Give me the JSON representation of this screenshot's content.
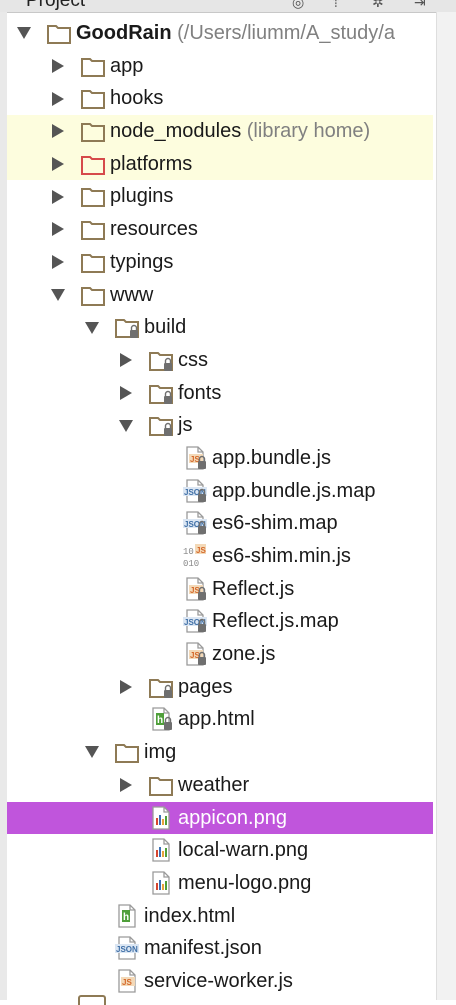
{
  "panel": {
    "title": "Project"
  },
  "colors": {
    "selection": "#c055dc",
    "highlight": "#fdfdde",
    "folder": "#8e7a55",
    "excluded_folder": "#d64a4a"
  },
  "tree": [
    {
      "name": "GoodRain",
      "note": " (/Users/liumm/A_study/a",
      "depth": 0,
      "arrow": "expanded",
      "icon": "folder",
      "bold": true
    },
    {
      "name": "app",
      "depth": 1,
      "arrow": "collapsed",
      "icon": "folder"
    },
    {
      "name": "hooks",
      "depth": 1,
      "arrow": "collapsed",
      "icon": "folder"
    },
    {
      "name": "node_modules",
      "note": " (library home)",
      "depth": 1,
      "arrow": "collapsed",
      "icon": "folder",
      "highlight": "yellow"
    },
    {
      "name": "platforms",
      "depth": 1,
      "arrow": "collapsed",
      "icon": "folder-red",
      "highlight": "yellow"
    },
    {
      "name": "plugins",
      "depth": 1,
      "arrow": "collapsed",
      "icon": "folder"
    },
    {
      "name": "resources",
      "depth": 1,
      "arrow": "collapsed",
      "icon": "folder"
    },
    {
      "name": "typings",
      "depth": 1,
      "arrow": "collapsed",
      "icon": "folder"
    },
    {
      "name": "www",
      "depth": 1,
      "arrow": "expanded",
      "icon": "folder"
    },
    {
      "name": "build",
      "depth": 2,
      "arrow": "expanded",
      "icon": "folder-locked"
    },
    {
      "name": "css",
      "depth": 3,
      "arrow": "collapsed",
      "icon": "folder-locked"
    },
    {
      "name": "fonts",
      "depth": 3,
      "arrow": "collapsed",
      "icon": "folder-locked"
    },
    {
      "name": "js",
      "depth": 3,
      "arrow": "expanded",
      "icon": "folder-locked"
    },
    {
      "name": "app.bundle.js",
      "depth": 4,
      "arrow": "none",
      "icon": "js-locked"
    },
    {
      "name": "app.bundle.js.map",
      "depth": 4,
      "arrow": "none",
      "icon": "json-locked"
    },
    {
      "name": "es6-shim.map",
      "depth": 4,
      "arrow": "none",
      "icon": "json-locked"
    },
    {
      "name": "es6-shim.min.js",
      "depth": 4,
      "arrow": "none",
      "icon": "binary-js"
    },
    {
      "name": "Reflect.js",
      "depth": 4,
      "arrow": "none",
      "icon": "js-locked"
    },
    {
      "name": "Reflect.js.map",
      "depth": 4,
      "arrow": "none",
      "icon": "json-locked"
    },
    {
      "name": "zone.js",
      "depth": 4,
      "arrow": "none",
      "icon": "js-locked"
    },
    {
      "name": "pages",
      "depth": 3,
      "arrow": "collapsed",
      "icon": "folder-locked"
    },
    {
      "name": "app.html",
      "depth": 3,
      "arrow": "none",
      "icon": "html-locked"
    },
    {
      "name": "img",
      "depth": 2,
      "arrow": "expanded",
      "icon": "folder"
    },
    {
      "name": "weather",
      "depth": 3,
      "arrow": "collapsed",
      "icon": "folder"
    },
    {
      "name": "appicon.png",
      "depth": 3,
      "arrow": "none",
      "icon": "image",
      "selected": true
    },
    {
      "name": "local-warn.png",
      "depth": 3,
      "arrow": "none",
      "icon": "image"
    },
    {
      "name": "menu-logo.png",
      "depth": 3,
      "arrow": "none",
      "icon": "image"
    },
    {
      "name": "index.html",
      "depth": 2,
      "arrow": "none",
      "icon": "html"
    },
    {
      "name": "manifest.json",
      "depth": 2,
      "arrow": "none",
      "icon": "json"
    },
    {
      "name": "service-worker.js",
      "depth": 2,
      "arrow": "none",
      "icon": "js"
    }
  ]
}
